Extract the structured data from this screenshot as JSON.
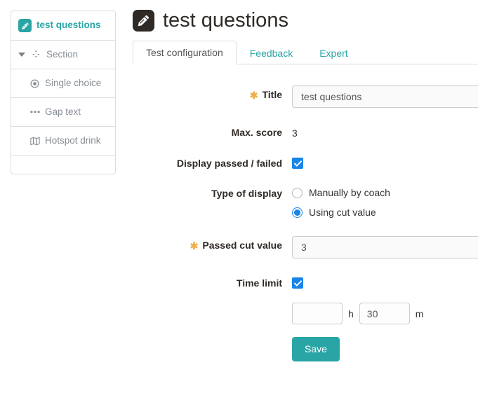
{
  "sidebar": {
    "items": [
      {
        "label": "test questions",
        "icon": "pencil-badge-icon",
        "active": true,
        "level": 0
      },
      {
        "label": "Section",
        "icon": "cubes-icon",
        "active": false,
        "level": 0,
        "caret": "chevron-down-icon"
      },
      {
        "label": "Single choice",
        "icon": "dot-circle-icon",
        "active": false,
        "level": 1
      },
      {
        "label": "Gap text",
        "icon": "ellipsis-icon",
        "active": false,
        "level": 1
      },
      {
        "label": "Hotspot drink",
        "icon": "map-icon",
        "active": false,
        "level": 1
      },
      {
        "label": "",
        "icon": "",
        "active": false,
        "level": 1
      }
    ]
  },
  "header": {
    "title": "test questions",
    "icon": "pencil-icon"
  },
  "tabs": [
    {
      "label": "Test configuration",
      "active": true
    },
    {
      "label": "Feedback",
      "active": false
    },
    {
      "label": "Expert",
      "active": false
    }
  ],
  "form": {
    "title": {
      "label": "Title",
      "required_marker": "✱",
      "value": "test questions",
      "placeholder": ""
    },
    "max_score": {
      "label": "Max. score",
      "value": "3"
    },
    "display_passed_failed": {
      "label": "Display passed / failed",
      "checked": true
    },
    "type_of_display": {
      "label": "Type of display",
      "options": [
        {
          "label": "Manually by coach",
          "selected": false
        },
        {
          "label": "Using cut value",
          "selected": true
        }
      ]
    },
    "passed_cut_value": {
      "label": "Passed cut value",
      "required_marker": "✱",
      "value": "3",
      "placeholder": ""
    },
    "time_limit": {
      "label": "Time limit",
      "checked": true,
      "hours_value": "",
      "hours_placeholder": "",
      "hours_unit": "h",
      "minutes_value": "30",
      "minutes_placeholder": "",
      "minutes_unit": "m"
    },
    "save_label": "Save"
  },
  "colors": {
    "accent_teal": "#2aa5a5",
    "required_orange": "#f0ad4e",
    "control_blue": "#1785e8",
    "title_dark": "#2f2a26",
    "muted_gray": "#888e95"
  }
}
